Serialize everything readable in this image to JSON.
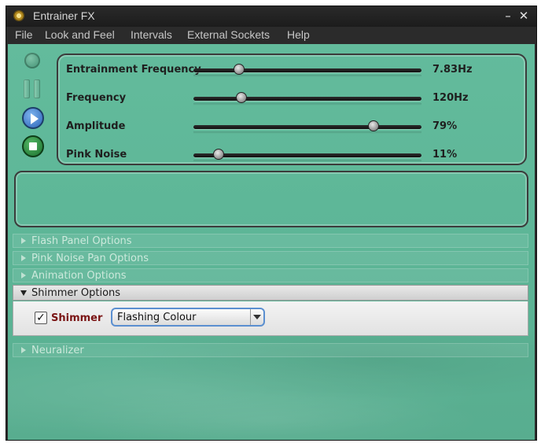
{
  "window": {
    "title": "Entrainer FX",
    "minimize_label": "–",
    "close_label": "✕"
  },
  "menu": {
    "items": [
      {
        "label": "File"
      },
      {
        "label": "Look and Feel"
      },
      {
        "label": "Intervals"
      },
      {
        "label": "External Sockets"
      },
      {
        "label": "Help"
      }
    ]
  },
  "transport": {
    "record_icon": "record-icon",
    "pause_icon": "pause-icon",
    "play_icon": "play-icon",
    "stop_icon": "stop-icon"
  },
  "sliders": [
    {
      "label": "Entrainment Frequency",
      "value": "7.83Hz",
      "fraction": 0.2
    },
    {
      "label": "Frequency",
      "value": "120Hz",
      "fraction": 0.21
    },
    {
      "label": "Amplitude",
      "value": "79%",
      "fraction": 0.79
    },
    {
      "label": "Pink Noise",
      "value": "11%",
      "fraction": 0.11
    }
  ],
  "sections": [
    {
      "label": "Flash Panel Options",
      "expanded": false
    },
    {
      "label": "Pink Noise Pan Options",
      "expanded": false
    },
    {
      "label": "Animation Options",
      "expanded": false
    },
    {
      "label": "Shimmer Options",
      "expanded": true
    },
    {
      "label": "Neuralizer",
      "expanded": false
    }
  ],
  "shimmer": {
    "checkbox_checked": true,
    "checkbox_mark": "✓",
    "checkbox_label": "Shimmer",
    "select_value": "Flashing Colour"
  },
  "colors": {
    "background": "#5db697",
    "label_red": "#7a1414",
    "select_border": "#5b8fd0"
  }
}
